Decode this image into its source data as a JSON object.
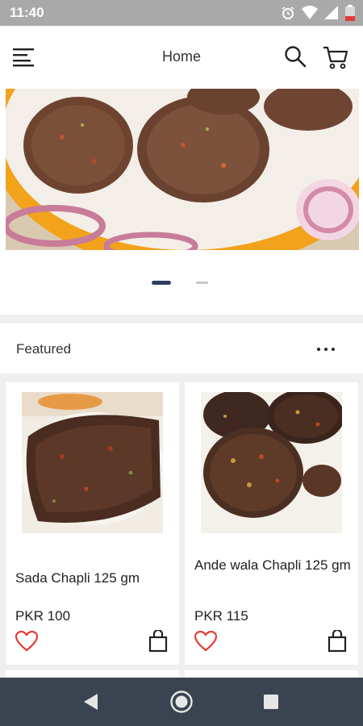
{
  "status_bar": {
    "time": "11:40"
  },
  "app_bar": {
    "title": "Home"
  },
  "banner": {
    "slides": 2,
    "active_slide": 1
  },
  "featured": {
    "title": "Featured",
    "products": [
      {
        "name": "Sada Chapli 125 gm",
        "price": "PKR 100"
      },
      {
        "name": "Ande wala Chapli 125 gm",
        "price": "PKR 115"
      }
    ]
  },
  "colors": {
    "accent": "#2c3e63",
    "heart": "#e53935",
    "nav_bar": "#3a4450"
  },
  "icons": [
    "menu-icon",
    "search-icon",
    "cart-icon",
    "more-icon",
    "heart-icon",
    "shopping-bag-icon",
    "back-icon",
    "home-icon",
    "recents-icon"
  ]
}
